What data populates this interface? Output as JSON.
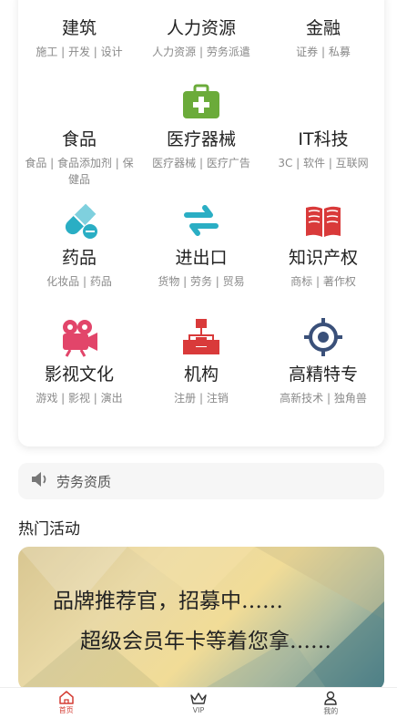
{
  "categories": [
    {
      "title": "建筑",
      "sub": "施工 | 开发 | 设计",
      "icon": "building-icon"
    },
    {
      "title": "人力资源",
      "sub": "人力资源 | 劳务派遣",
      "icon": "people-icon"
    },
    {
      "title": "金融",
      "sub": "证券 | 私募",
      "icon": "finance-icon"
    },
    {
      "title": "食品",
      "sub": "食品 | 食品添加剂 | 保健品",
      "icon": "food-icon"
    },
    {
      "title": "医疗器械",
      "sub": "医疗器械 | 医疗广告",
      "icon": "medical-kit-icon"
    },
    {
      "title": "IT科技",
      "sub": "3C | 软件 | 互联网",
      "icon": "tech-icon"
    },
    {
      "title": "药品",
      "sub": "化妆品 | 药品",
      "icon": "pill-icon"
    },
    {
      "title": "进出口",
      "sub": "货物 | 劳务 | 贸易",
      "icon": "exchange-arrows-icon"
    },
    {
      "title": "知识产权",
      "sub": "商标 | 著作权",
      "icon": "book-icon"
    },
    {
      "title": "影视文化",
      "sub": "游戏 | 影视 | 演出",
      "icon": "movie-camera-icon"
    },
    {
      "title": "机构",
      "sub": "注册 | 注销",
      "icon": "org-chart-icon"
    },
    {
      "title": "高精特专",
      "sub": "高新技术 | 独角兽",
      "icon": "target-icon"
    }
  ],
  "notice": {
    "text": "劳务资质",
    "icon": "speaker-icon"
  },
  "hot": {
    "title": "热门活动"
  },
  "banner": {
    "line1": "品牌推荐官，招募中……",
    "line2": "超级会员年卡等着您拿……"
  },
  "tabs": [
    {
      "label": "首页",
      "icon": "home-icon",
      "active": true
    },
    {
      "label": "VIP",
      "icon": "crown-icon",
      "active": false
    },
    {
      "label": "我的",
      "icon": "user-icon",
      "active": false
    }
  ],
  "colors": {
    "accent": "#d43c33",
    "green": "#6bab3a",
    "teal": "#2aaec4",
    "red": "#d93a3a",
    "pink": "#e2456a",
    "navy": "#3a5079"
  }
}
